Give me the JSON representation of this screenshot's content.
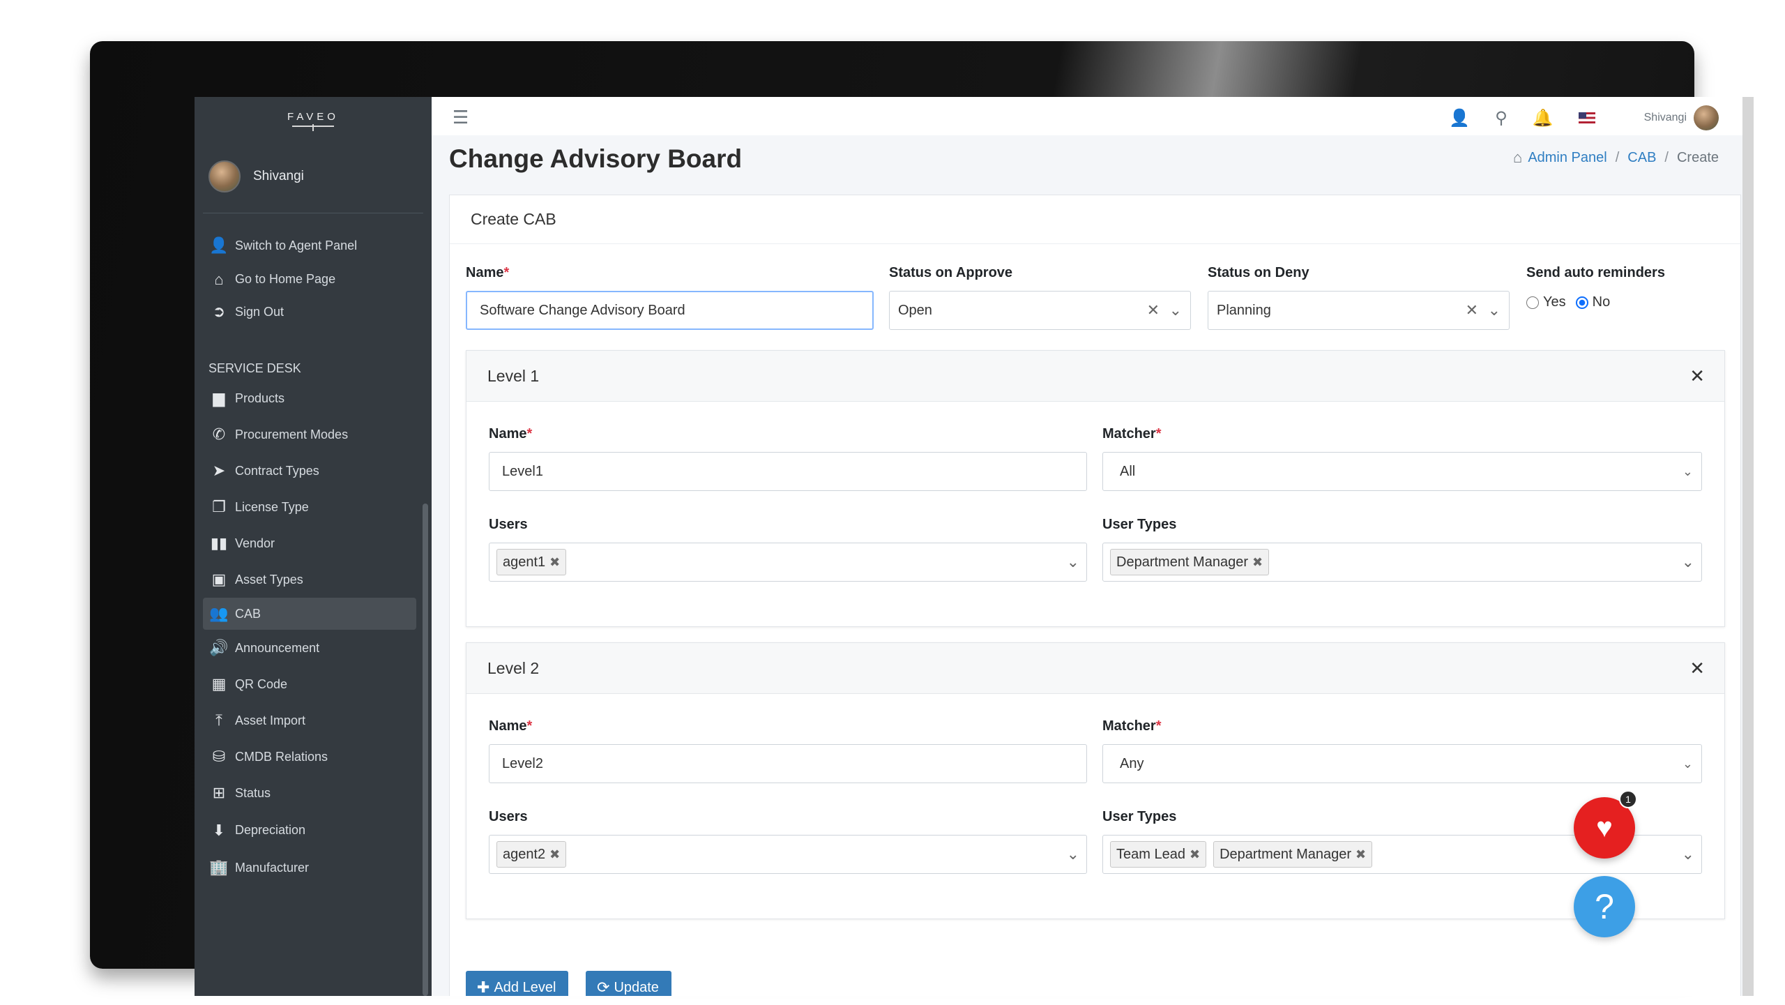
{
  "brand": "FAVEO",
  "sidebar": {
    "user_name": "Shivangi",
    "top_items": [
      {
        "label": "Switch to Agent Panel",
        "icon": "user-switch-icon"
      },
      {
        "label": "Go to Home Page",
        "icon": "home-icon"
      },
      {
        "label": "Sign Out",
        "icon": "sign-out-icon"
      }
    ],
    "section_header": "SERVICE DESK",
    "items": [
      {
        "label": "Products",
        "icon": "products-icon"
      },
      {
        "label": "Procurement Modes",
        "icon": "phone-icon"
      },
      {
        "label": "Contract Types",
        "icon": "paper-plane-icon"
      },
      {
        "label": "License Type",
        "icon": "copy-icon"
      },
      {
        "label": "Vendor",
        "icon": "barcode-icon"
      },
      {
        "label": "Asset Types",
        "icon": "briefcase-icon"
      },
      {
        "label": "CAB",
        "icon": "users-icon"
      },
      {
        "label": "Announcement",
        "icon": "megaphone-icon"
      },
      {
        "label": "QR Code",
        "icon": "qrcode-icon"
      },
      {
        "label": "Asset Import",
        "icon": "upload-icon"
      },
      {
        "label": "CMDB Relations",
        "icon": "database-icon"
      },
      {
        "label": "Status",
        "icon": "plus-square-icon"
      },
      {
        "label": "Depreciation",
        "icon": "arrow-circle-down-icon"
      },
      {
        "label": "Manufacturer",
        "icon": "building-icon"
      }
    ],
    "active_item": "CAB"
  },
  "topbar": {
    "user_name": "Shivangi"
  },
  "page": {
    "title": "Change Advisory Board",
    "breadcrumb": [
      "Admin Panel",
      "CAB",
      "Create"
    ]
  },
  "form": {
    "card_title": "Create CAB",
    "name_label": "Name",
    "name_value": "Software Change Advisory Board",
    "status_approve_label": "Status on Approve",
    "status_approve_value": "Open",
    "status_deny_label": "Status on Deny",
    "status_deny_value": "Planning",
    "reminders_label": "Send auto reminders",
    "reminder_yes": "Yes",
    "reminder_no": "No",
    "reminder_selected": "No",
    "levels": [
      {
        "title": "Level 1",
        "name_label": "Name",
        "name_value": "Level1",
        "matcher_label": "Matcher",
        "matcher_value": "All",
        "users_label": "Users",
        "users": [
          "agent1"
        ],
        "user_types_label": "User Types",
        "user_types": [
          "Department Manager"
        ]
      },
      {
        "title": "Level 2",
        "name_label": "Name",
        "name_value": "Level2",
        "matcher_label": "Matcher",
        "matcher_value": "Any",
        "users_label": "Users",
        "users": [
          "agent2"
        ],
        "user_types_label": "User Types",
        "user_types": [
          "Team Lead",
          "Department Manager"
        ]
      }
    ],
    "add_level_label": "Add Level",
    "update_label": "Update"
  },
  "floating": {
    "health_badge": "1",
    "help_label": "?"
  },
  "colors": {
    "sidebar_bg": "#343a40",
    "primary_button": "#337ab7",
    "link": "#2f7ec2",
    "required": "#dc3545",
    "fab_red": "#e52020",
    "fab_blue": "#3d9fe6"
  }
}
